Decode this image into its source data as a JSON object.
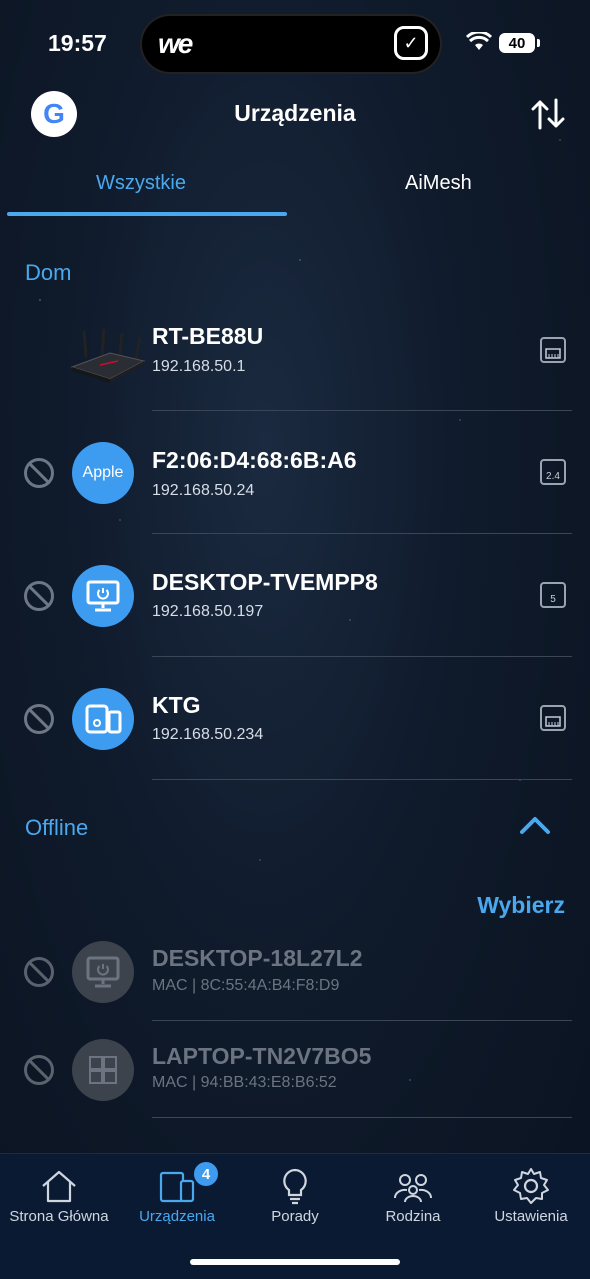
{
  "status_bar": {
    "time": "19:57",
    "battery": "40"
  },
  "header": {
    "title": "Urządzenia",
    "google_glyph": "G"
  },
  "tabs": [
    {
      "label": "Wszystkie",
      "active": true
    },
    {
      "label": "AiMesh",
      "active": false
    }
  ],
  "sections": {
    "home": "Dom",
    "offline": "Offline",
    "select": "Wybierz"
  },
  "devices": [
    {
      "name": "RT-BE88U",
      "ip": "192.168.50.1",
      "icon": "router-image",
      "connection": "ethernet-icon"
    },
    {
      "name": "F2:06:D4:68:6B:A6",
      "ip": "192.168.50.24",
      "avatar_text": "Apple",
      "connection": "wifi-2.4-icon",
      "conn_label": "2.4"
    },
    {
      "name": "DESKTOP-TVEMPP8",
      "ip": "192.168.50.197",
      "icon": "desktop-icon",
      "connection": "wifi-5-icon",
      "conn_label": "5"
    },
    {
      "name": "KTG",
      "ip": "192.168.50.234",
      "icon": "devices-icon",
      "connection": "ethernet-icon"
    }
  ],
  "offline_devices": [
    {
      "name": "DESKTOP-18L27L2",
      "mac": "MAC | 8C:55:4A:B4:F8:D9",
      "icon": "desktop-icon"
    },
    {
      "name": "LAPTOP-TN2V7BO5",
      "mac": "MAC | 94:BB:43:E8:B6:52",
      "icon": "windows-icon"
    }
  ],
  "nav": [
    {
      "label": "Strona Główna",
      "icon": "home-icon"
    },
    {
      "label": "Urządzenia",
      "icon": "devices-icon",
      "active": true,
      "badge": "4"
    },
    {
      "label": "Porady",
      "icon": "lightbulb-icon"
    },
    {
      "label": "Rodzina",
      "icon": "family-icon"
    },
    {
      "label": "Ustawienia",
      "icon": "gear-icon"
    }
  ],
  "colors": {
    "accent": "#4aa9ee",
    "avatar": "#3d9cf0",
    "nav_bg": "#0b1a33"
  }
}
